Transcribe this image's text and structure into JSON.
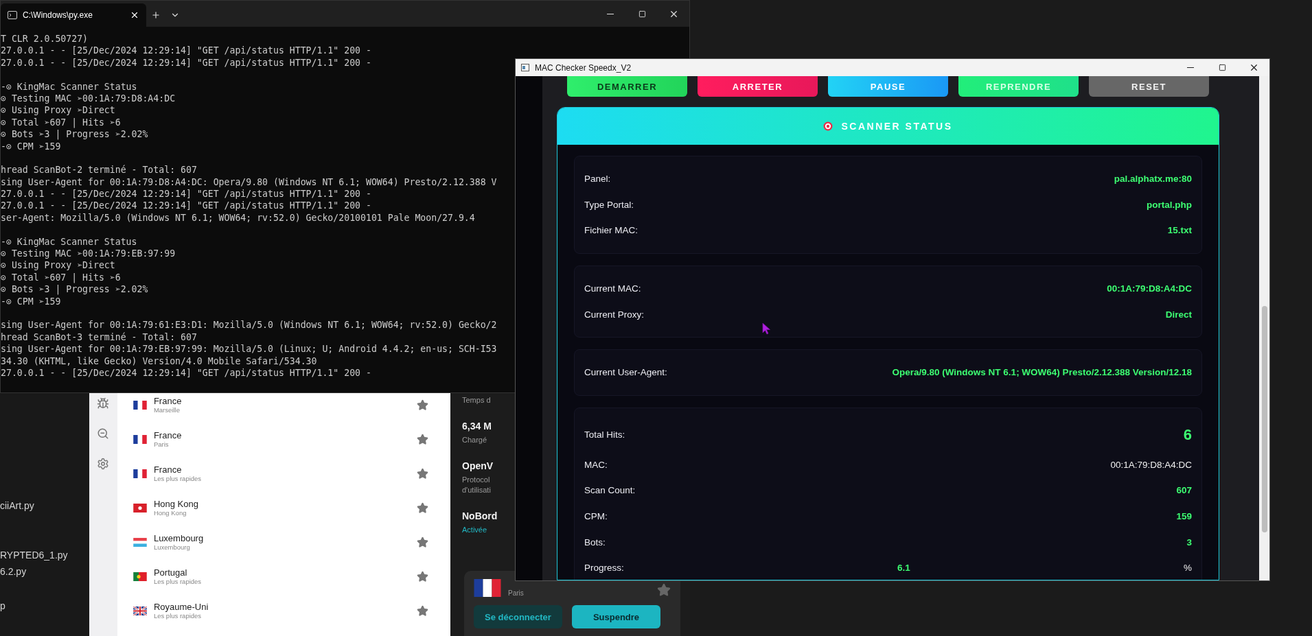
{
  "terminal": {
    "tab_title": "C:\\Windows\\py.exe",
    "blocks": [
      [
        "T CLR 2.0.50727)",
        "27.0.0.1 - - [25/Dec/2024 12:29:14] \"GET /api/status HTTP/1.1\" 200 -",
        "27.0.0.1 - - [25/Dec/2024 12:29:14] \"GET /api/status HTTP/1.1\" 200 -"
      ],
      [
        "-⊙ KingMac Scanner Status",
        "⊙ Testing MAC ➢00:1A:79:D8:A4:DC",
        "⊙ Using Proxy ➢Direct",
        "⊙ Total ➢607 | Hits ➢6",
        "⊙ Bots ➢3 | Progress ➢2.02%",
        "-⊙ CPM ➢159"
      ],
      [
        "hread ScanBot-2 terminé - Total: 607",
        "sing User-Agent for 00:1A:79:D8:A4:DC: Opera/9.80 (Windows NT 6.1; WOW64) Presto/2.12.388 V",
        "27.0.0.1 - - [25/Dec/2024 12:29:14] \"GET /api/status HTTP/1.1\" 200 -",
        "27.0.0.1 - - [25/Dec/2024 12:29:14] \"GET /api/status HTTP/1.1\" 200 -",
        "ser-Agent: Mozilla/5.0 (Windows NT 6.1; WOW64; rv:52.0) Gecko/20100101 Pale Moon/27.9.4"
      ],
      [
        "-⊙ KingMac Scanner Status",
        "⊙ Testing MAC ➢00:1A:79:EB:97:99",
        "⊙ Using Proxy ➢Direct",
        "⊙ Total ➢607 | Hits ➢6",
        "⊙ Bots ➢3 | Progress ➢2.02%",
        "-⊙ CPM ➢159"
      ],
      [
        "sing User-Agent for 00:1A:79:61:E3:D1: Mozilla/5.0 (Windows NT 6.1; WOW64; rv:52.0) Gecko/2",
        "hread ScanBot-3 terminé - Total: 607",
        "sing User-Agent for 00:1A:79:EB:97:99: Mozilla/5.0 (Linux; U; Android 4.4.2; en-us; SCH-I53",
        "34.30 (KHTML, like Gecko) Version/4.0 Mobile Safari/534.30",
        "27.0.0.1 - - [25/Dec/2024 12:29:14] \"GET /api/status HTTP/1.1\" 200 -"
      ]
    ]
  },
  "explorer": {
    "files": [
      "ciiArt.py",
      "RYPTED6_1.py",
      "6.2.py",
      "p"
    ]
  },
  "vpn": {
    "servers": [
      {
        "name": "France",
        "detail": "Marseille",
        "kind": "france"
      },
      {
        "name": "France",
        "detail": "Paris",
        "kind": "france"
      },
      {
        "name": "France",
        "detail": "Les plus rapides",
        "kind": "france"
      },
      {
        "name": "Hong Kong",
        "detail": "Hong Kong",
        "kind": "hongkong"
      },
      {
        "name": "Luxembourg",
        "detail": "Luxembourg",
        "kind": "luxembourg"
      },
      {
        "name": "Portugal",
        "detail": "Les plus rapides",
        "kind": "portugal"
      },
      {
        "name": "Royaume-Uni",
        "detail": "Les plus rapides",
        "kind": "uk"
      }
    ],
    "info": [
      {
        "lines": [
          "Temps d"
        ]
      },
      {
        "title": "6,34 M",
        "lines": [
          "Chargé"
        ]
      },
      {
        "title": "OpenV",
        "lines": [
          "Protocol",
          "d'utilisati"
        ]
      },
      {
        "title": "NoBord",
        "lines": [
          "Activée"
        ],
        "kind": "status"
      }
    ],
    "connection": {
      "detail": "Paris",
      "kind": "france",
      "buttons": [
        {
          "label": "Se déconnecter",
          "kind": "secondary"
        },
        {
          "label": "Suspendre",
          "kind": "primary"
        }
      ]
    }
  },
  "checker": {
    "title": "MAC Checker Speedx_V2",
    "buttons": [
      {
        "label": "DEMARRER",
        "kind": "start"
      },
      {
        "label": "ARRETER",
        "kind": "stop"
      },
      {
        "label": "PAUSE",
        "kind": "pause"
      },
      {
        "label": "REPRENDRE",
        "kind": "resume"
      },
      {
        "label": "RESET",
        "kind": "reset"
      }
    ],
    "status": {
      "title": "SCANNER STATUS",
      "sections": [
        [
          {
            "label": "Panel:",
            "value": "pal.alphatx.me:80",
            "kind": "value"
          },
          {
            "label": "Type Portal:",
            "value": "portal.php",
            "kind": "value"
          },
          {
            "label": "Fichier MAC:",
            "value": "15.txt",
            "kind": "value"
          }
        ],
        [
          {
            "label": "Current MAC:",
            "value": "00:1A:79:D8:A4:DC",
            "kind": "value"
          },
          {
            "label": "Current Proxy:",
            "value": "Direct",
            "kind": "value"
          }
        ],
        [
          {
            "label": "Current User-Agent:",
            "value": "Opera/9.80 (Windows NT 6.1; WOW64) Presto/2.12.388 Version/12.18",
            "kind": "value"
          }
        ],
        [
          {
            "label": "Total Hits:",
            "value": "6",
            "kind": "big"
          },
          {
            "label": "MAC:",
            "value": "00:1A:79:D8:A4:DC",
            "kind": "plain"
          },
          {
            "label": "Scan Count:",
            "value": "607",
            "kind": "value"
          },
          {
            "label": "CPM:",
            "value": "159",
            "kind": "value"
          },
          {
            "label": "Bots:",
            "value": "3",
            "kind": "value"
          },
          {
            "label": "Progress:",
            "value": "6.1",
            "unit": "%",
            "kind": "split"
          }
        ]
      ]
    }
  }
}
